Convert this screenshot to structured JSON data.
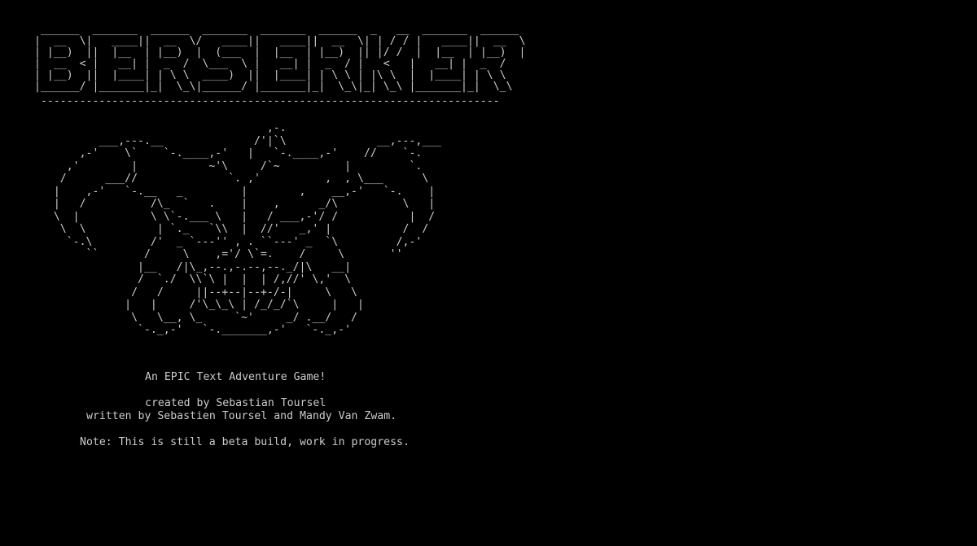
{
  "ascii_title": " ______  _______  ______  _______  _______  ______  _   __  _______  ______\n|  __  \\|   ____||  __  \\/   ____||   ____||  __  \\| | / / |   ____||  __  \\\n| |__)  ||  |__  | |__)  |  (___  |  |__  | |__)  || |/ /  |  |__  | |__)  |\n|  __  < |   __| |  _  /  \\___  \\ |   __| |  _  / |   <   |   __| |  _  /\n| |__)  ||  |____| | \\ \\  ____)  ||  |____| | \\ \\ | |\\ \\  |  |____| | \\ \\\n|______/ |_______|_|  \\_\\|______/ |_______|_|  \\_\\|_| \\_\\ |_______|_|  \\_\\",
  "divider": " -----------------------------------------------------------------------",
  "ascii_helmet": "                                    ,-.\n          ___,---.__              /'|`\\              __,---,___\n       ,-'    \\`    `-.____,-'   |   `-.____,-'    //    `-.\n     ,'        |           ~'\\     /`~          |         `.\n    /      ___//              `. ,'          ,  , \\___      \\\n   |    ,-'   `-.__   _         |        ,    __,-'   `-.    |\n   |   /          /\\_  `   .    |    ,      _/\\          \\   |\n   \\  |           \\ \\`-.___ \\   |   / ___,-'/ /           |  /\n    \\  \\           | `._   `\\\\  |  //'   _,' |           /  /\n     `-.\\         /'  _ `---'' , . ``---' _  `\\         /,-'\n        ``       /     \\    ,='/ \\`=.    /     \\       ''\n                |__   /|\\_,--.,-.--,--._/|\\   __|\n                /  `./  \\\\`\\ |  |  | /,//' \\,'  \\\n               /   /     ||--+--|--+-/-|     \\   \\\n              |   |     /'\\_\\_\\ | /_/_/`\\     |   |\n               \\   \\__, \\_     `~'     _/ .__/   /\n                `-._,-'   `-._______,-'   `-._,-'",
  "tagline": "An EPIC Text Adventure Game!",
  "credits": {
    "created": "created by Sebastian Toursel",
    "written": "written by Sebastien Toursel and Mandy Van Zwam."
  },
  "note": "Note: This is still a beta build, work in progress.",
  "colors": {
    "background": "#000000",
    "text": "#cccccc"
  }
}
